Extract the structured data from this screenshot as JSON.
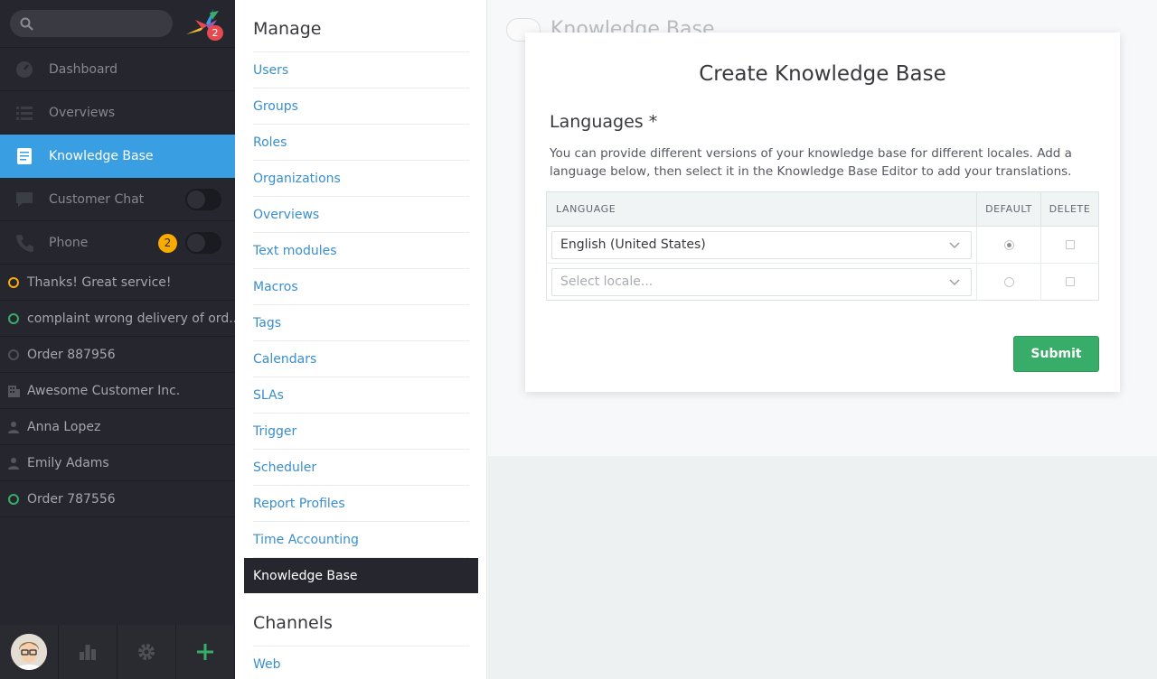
{
  "nav": {
    "notification_count": "2",
    "main_items": [
      {
        "label": "Dashboard",
        "icon": "dashboard-icon"
      },
      {
        "label": "Overviews",
        "icon": "list-icon"
      },
      {
        "label": "Knowledge Base",
        "icon": "document-icon",
        "active": true
      },
      {
        "label": "Customer Chat",
        "icon": "chat-icon",
        "toggle": "off"
      },
      {
        "label": "Phone",
        "icon": "phone-icon",
        "badge": "2",
        "toggle": "off"
      }
    ],
    "tasks": [
      {
        "label": "Thanks! Great service!",
        "icon": "ticket-pending-icon",
        "status_color": "#faab00"
      },
      {
        "label": "complaint wrong delivery of ord...",
        "icon": "ticket-open-icon",
        "status_color": "#38ad69"
      },
      {
        "label": "Order 887956",
        "icon": "ticket-closed-icon",
        "status_color": "#4e5058"
      },
      {
        "label": "Awesome Customer Inc.",
        "icon": "organization-icon"
      },
      {
        "label": "Anna Lopez",
        "icon": "user-icon"
      },
      {
        "label": "Emily Adams",
        "icon": "user-icon"
      },
      {
        "label": "Order 787556",
        "icon": "ticket-open-icon",
        "status_color": "#38ad69"
      }
    ],
    "bottom": [
      "avatar",
      "stats-icon",
      "gear-icon",
      "plus-icon"
    ]
  },
  "manage": {
    "heading": "Manage",
    "items": [
      "Users",
      "Groups",
      "Roles",
      "Organizations",
      "Overviews",
      "Text modules",
      "Macros",
      "Tags",
      "Calendars",
      "SLAs",
      "Trigger",
      "Scheduler",
      "Report Profiles",
      "Time Accounting",
      "Knowledge Base"
    ],
    "active_item": "Knowledge Base",
    "channels_heading": "Channels",
    "channels": [
      "Web"
    ]
  },
  "background": {
    "title": "Knowledge Base"
  },
  "modal": {
    "title": "Create Knowledge Base",
    "section": "Languages *",
    "description": "You can provide different versions of your knowledge base for different locales. Add a language below, then select it in the Knowledge Base Editor to add your translations.",
    "table": {
      "headers": [
        "LANGUAGE",
        "DEFAULT",
        "DELETE"
      ],
      "rows": [
        {
          "language": "English (United States)",
          "default": true
        },
        {
          "language": "",
          "placeholder": "Select locale...",
          "default": false
        }
      ]
    },
    "submit_label": "Submit"
  },
  "colors": {
    "accent": "#3a9fe2",
    "nav_bg": "#26272e",
    "link": "#3a8ecb",
    "success": "#38ad69",
    "warning": "#faab00",
    "danger": "#e54a4f"
  }
}
